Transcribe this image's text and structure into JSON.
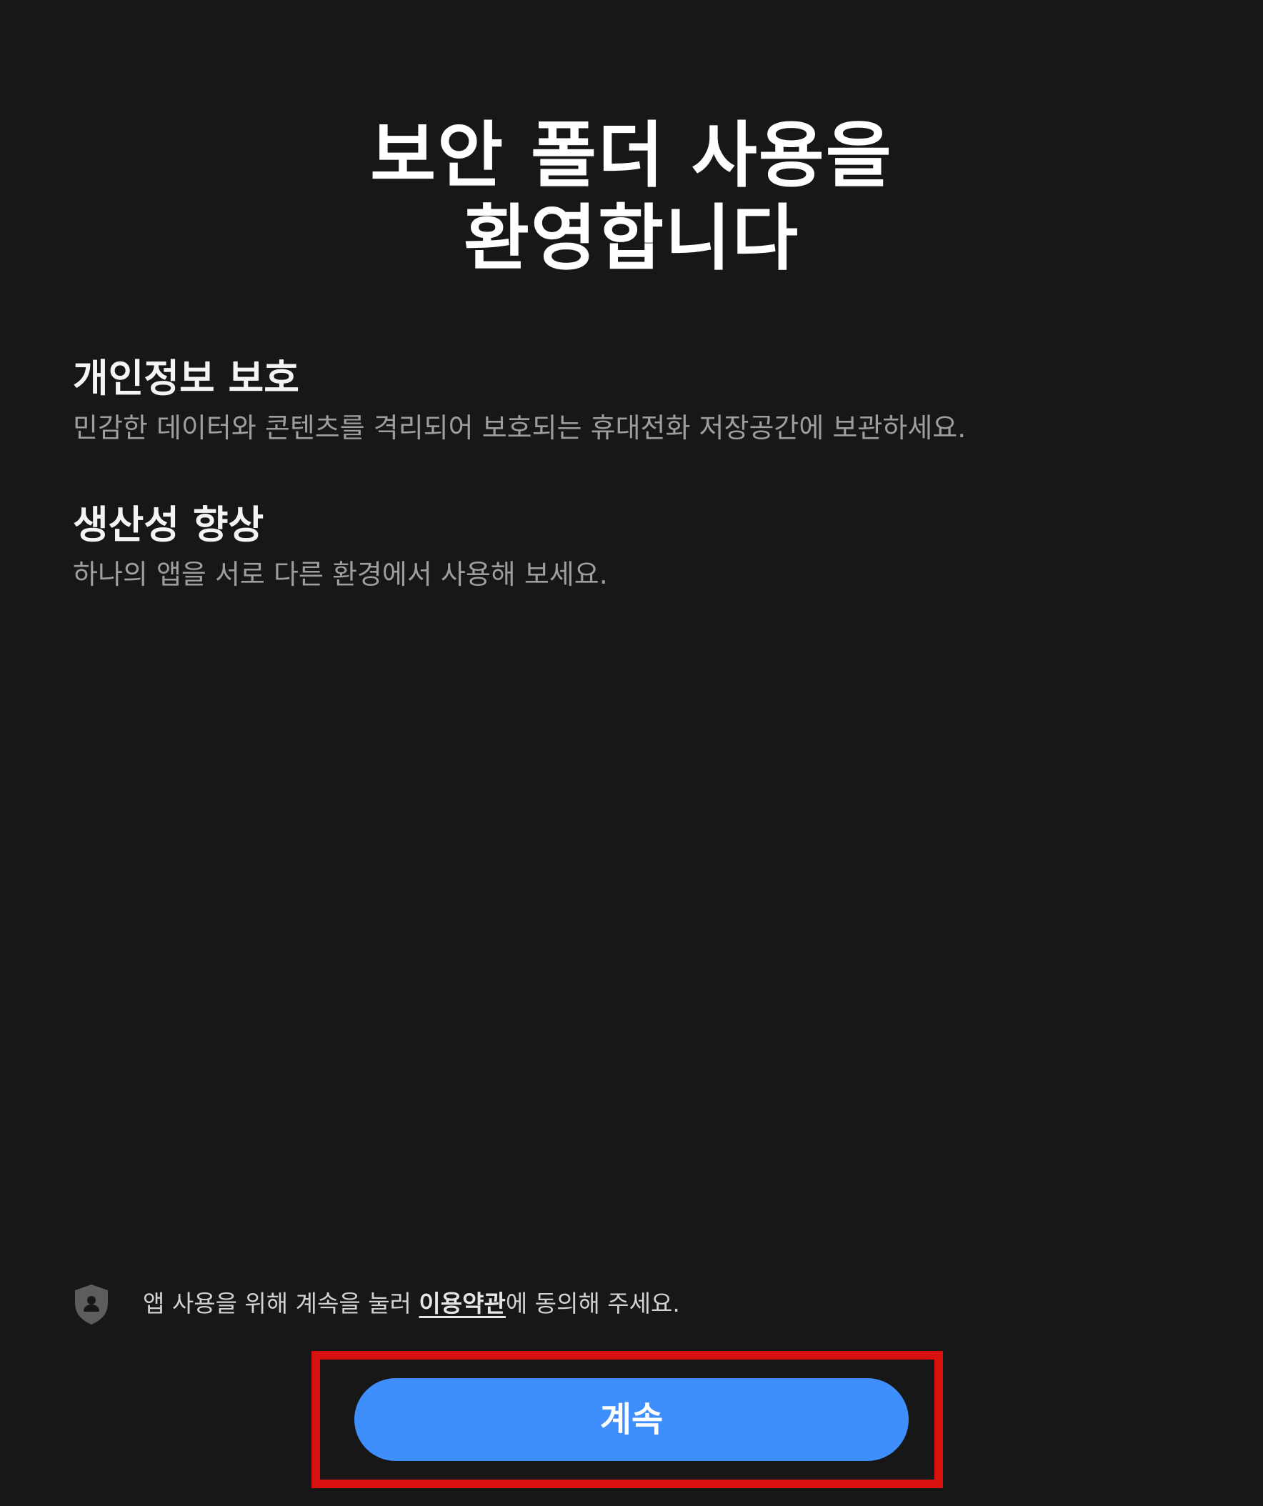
{
  "header": {
    "title_line1": "보안 폴더 사용을",
    "title_line2": "환영합니다"
  },
  "features": [
    {
      "heading": "개인정보 보호",
      "description": "민감한 데이터와 콘텐츠를 격리되어 보호되는 휴대전화 저장공간에 보관하세요."
    },
    {
      "heading": "생산성 향상",
      "description": "하나의 앱을 서로 다른 환경에서 사용해 보세요."
    }
  ],
  "notice": {
    "icon": "shield-person-icon",
    "text_before": "앱 사용을 위해 계속을 눌러 ",
    "terms_link": "이용약관",
    "text_after": "에 동의해 주세요."
  },
  "footer": {
    "continue_label": "계속"
  },
  "colors": {
    "background": "#171717",
    "accent": "#3e8ffc",
    "highlight_border": "#d8100f",
    "secondary_text": "#9e9e9e"
  }
}
